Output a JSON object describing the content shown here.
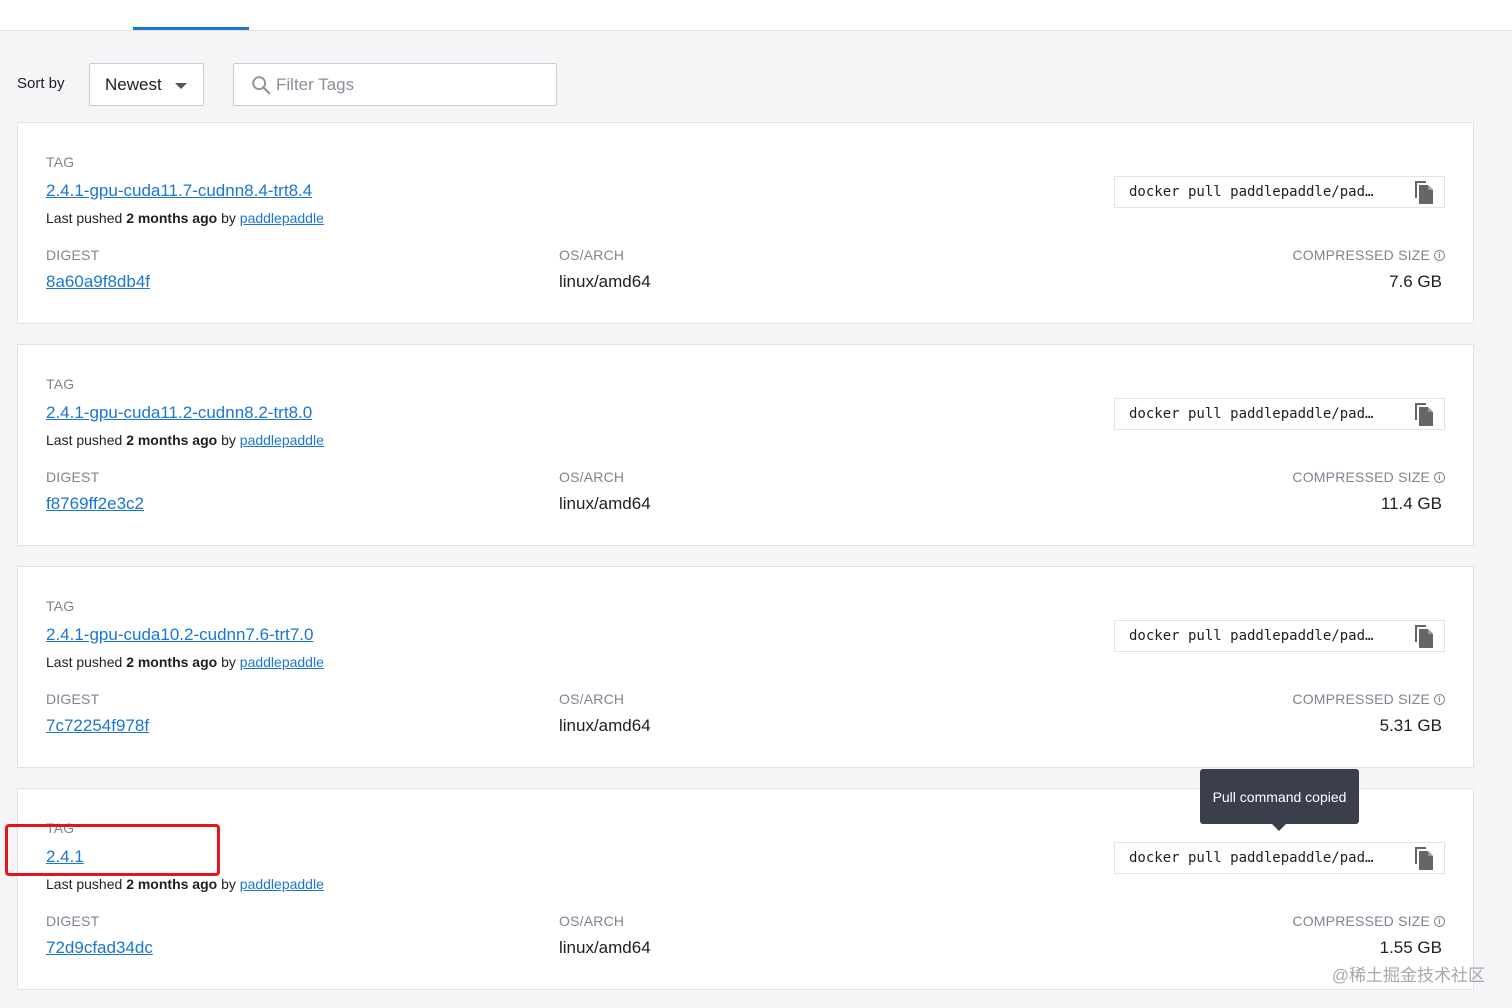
{
  "toolbar": {
    "sort_label": "Sort by",
    "sort_value": "Newest",
    "filter_placeholder": "Filter Tags"
  },
  "labels": {
    "tag": "TAG",
    "digest": "DIGEST",
    "os_arch": "OS/ARCH",
    "compressed_size": "COMPRESSED SIZE",
    "last_pushed_prefix": "Last pushed",
    "by": "by"
  },
  "tags": [
    {
      "name": "2.4.1-gpu-cuda11.7-cudnn8.4-trt8.4",
      "pushed_ago": "2 months ago",
      "pushed_by": "paddlepaddle",
      "pull_command": "docker pull paddlepaddle/pad…",
      "digest": "8a60a9f8db4f",
      "os_arch": "linux/amd64",
      "size": "7.6 GB"
    },
    {
      "name": "2.4.1-gpu-cuda11.2-cudnn8.2-trt8.0",
      "pushed_ago": "2 months ago",
      "pushed_by": "paddlepaddle",
      "pull_command": "docker pull paddlepaddle/pad…",
      "digest": "f8769ff2e3c2",
      "os_arch": "linux/amd64",
      "size": "11.4 GB"
    },
    {
      "name": "2.4.1-gpu-cuda10.2-cudnn7.6-trt7.0",
      "pushed_ago": "2 months ago",
      "pushed_by": "paddlepaddle",
      "pull_command": "docker pull paddlepaddle/pad…",
      "digest": "7c72254f978f",
      "os_arch": "linux/amd64",
      "size": "5.31 GB"
    },
    {
      "name": "2.4.1",
      "pushed_ago": "2 months ago",
      "pushed_by": "paddlepaddle",
      "pull_command": "docker pull paddlepaddle/pad…",
      "digest": "72d9cfad34dc",
      "os_arch": "linux/amd64",
      "size": "1.55 GB"
    }
  ],
  "tooltip": "Pull command copied",
  "watermark": "@稀土掘金技术社区",
  "colors": {
    "link": "#1976d2",
    "highlight": "#e5141b",
    "tooltip_bg": "#3a3f4b"
  }
}
